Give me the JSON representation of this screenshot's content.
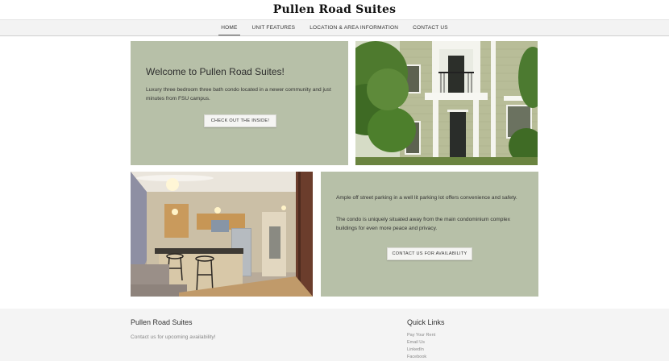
{
  "site": {
    "title": "Pullen Road Suites"
  },
  "nav": {
    "items": [
      {
        "label": "HOME"
      },
      {
        "label": "UNIT FEATURES"
      },
      {
        "label": "LOCATION & AREA INFORMATION"
      },
      {
        "label": "CONTACT US"
      }
    ]
  },
  "welcome": {
    "heading": "Welcome to Pullen Road Suites!",
    "text": "Luxury three bedroom three bath condo located in a newer community and just minutes from FSU campus.",
    "button": "CHECK OUT THE INSIDE!"
  },
  "parking": {
    "text1": "Ample off street parking in a well lit parking lot offers convenience and safety.",
    "text2": "The condo is uniquely situated away from the main condominium complex buildings for even more peace and privacy.",
    "button": "CONTACT US FOR AVAILABILITY"
  },
  "footer": {
    "title": "Pullen Road Suites",
    "subtitle": "Contact us for upcoming availability!",
    "quick_links_title": "Quick Links",
    "links": [
      {
        "label": "Pay Your Rent"
      },
      {
        "label": "Email Us"
      },
      {
        "label": "LinkedIn"
      },
      {
        "label": "Facebook"
      }
    ]
  },
  "colors": {
    "panel": "#b7c0a8",
    "footer_bg": "#f4f4f4",
    "nav_bg": "#f3f3f3"
  }
}
